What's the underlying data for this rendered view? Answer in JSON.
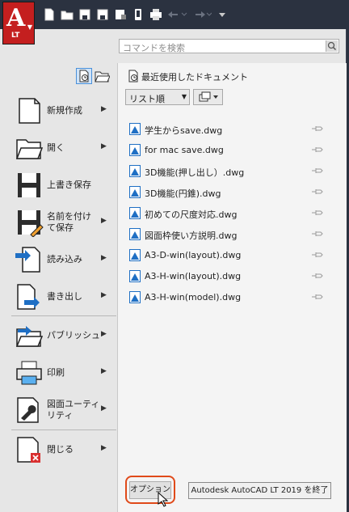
{
  "app": {
    "logo_letter": "A",
    "edition": "LT"
  },
  "search": {
    "placeholder": "コマンドを検索"
  },
  "menu": {
    "items": [
      {
        "label": "新規作成"
      },
      {
        "label": "開く"
      },
      {
        "label": "上書き保存"
      },
      {
        "label": "名前を付け\nて保存"
      },
      {
        "label": "読み込み"
      },
      {
        "label": "書き出し"
      },
      {
        "label": "パブリッシュ"
      },
      {
        "label": "印刷"
      },
      {
        "label": "図面ユーティ\nリティ"
      },
      {
        "label": "閉じる"
      }
    ]
  },
  "recent": {
    "title": "最近使用したドキュメント",
    "sort_selected": "リスト順",
    "files": [
      "学生からsave.dwg",
      "for mac save.dwg",
      "3D機能(押し出し）.dwg",
      "3D機能(円錐).dwg",
      "初めての尺度対応.dwg",
      "図面枠使い方説明.dwg",
      "A3-D-win(layout).dwg",
      "A3-H-win(layout).dwg",
      "A3-H-win(model).dwg"
    ]
  },
  "footer": {
    "options_label": "オプション",
    "exit_label": "Autodesk AutoCAD LT 2019 を終了"
  },
  "colors": {
    "brand": "#c41f1f",
    "highlight_ring": "#e04a1a",
    "file_icon": "#1f6fc4"
  }
}
